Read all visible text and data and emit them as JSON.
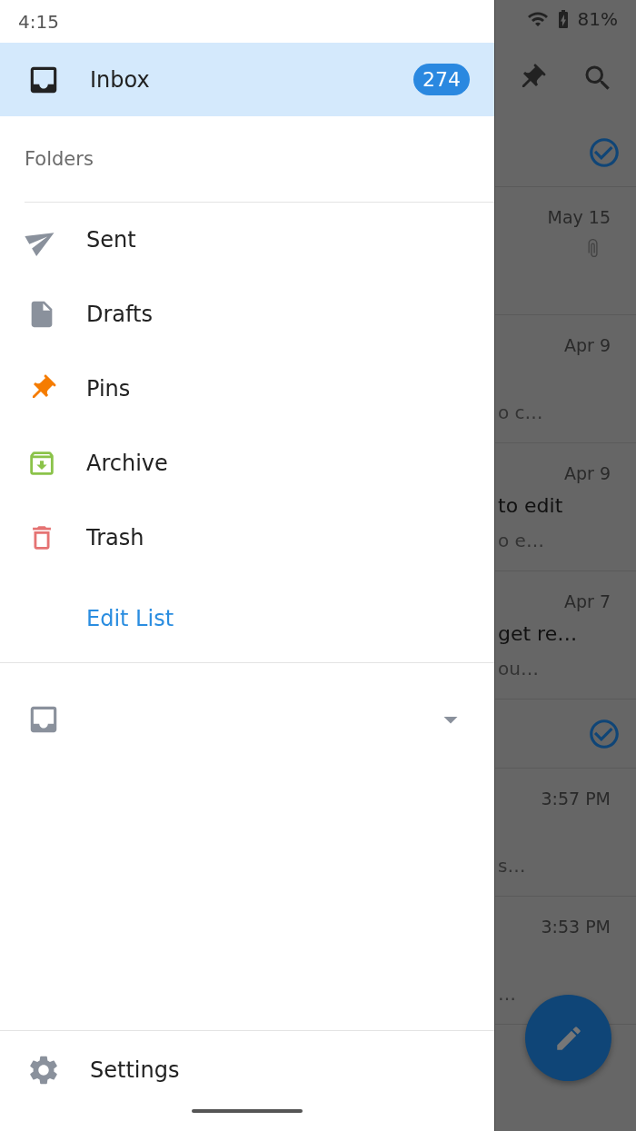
{
  "status_bar": {
    "time": "4:15",
    "battery": "81%"
  },
  "drawer": {
    "inbox": {
      "label": "Inbox",
      "count": "274",
      "selected": true
    },
    "folders_heading": "Folders",
    "folders": [
      {
        "kind": "sent",
        "label": "Sent",
        "color": "#8a919c",
        "selected": false
      },
      {
        "kind": "drafts",
        "label": "Drafts",
        "color": "#8a919c",
        "selected": false
      },
      {
        "kind": "pins",
        "label": "Pins",
        "color": "#f57c00",
        "selected": false
      },
      {
        "kind": "archive",
        "label": "Archive",
        "color": "#8bc34a",
        "selected": false
      },
      {
        "kind": "trash",
        "label": "Trash",
        "color": "#e57373",
        "selected": false
      }
    ],
    "edit_link": "Edit List",
    "settings": "Settings"
  },
  "messages": [
    {
      "kind": "header"
    },
    {
      "kind": "message",
      "date": "May 15",
      "attachment": true
    },
    {
      "kind": "message",
      "date": "Apr 9",
      "preview": "o c…"
    },
    {
      "kind": "message",
      "date": "Apr 9",
      "subject": "to edit",
      "preview": "o e…"
    },
    {
      "kind": "message",
      "date": "Apr 7",
      "subject": "get re…",
      "preview": "ou…"
    },
    {
      "kind": "header"
    },
    {
      "kind": "message",
      "date": "3:57 PM",
      "preview": "s…"
    },
    {
      "kind": "message",
      "date": "3:53 PM",
      "preview": "…"
    }
  ]
}
